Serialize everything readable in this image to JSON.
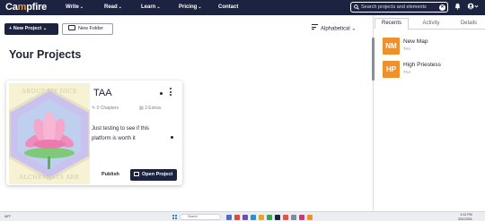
{
  "brand": {
    "name_start": "Ca",
    "name_flame": "m",
    "name_end": "pfire"
  },
  "nav": {
    "items": [
      {
        "label": "Write",
        "has_menu": true
      },
      {
        "label": "Read",
        "has_menu": true
      },
      {
        "label": "Learn",
        "has_menu": true
      },
      {
        "label": "Pricing",
        "has_menu": true
      },
      {
        "label": "Contact",
        "has_menu": false
      }
    ],
    "chevron": "⌄",
    "search_placeholder": "Search projects and elements",
    "search_icon": "search-icon",
    "clear_icon": "✕",
    "bell_icon": "bell-icon",
    "account_icon": "user-icon"
  },
  "toolbar": {
    "new_project_label": "+ New Project ⌄",
    "new_folder_label": "New Folder",
    "sort_label": "Alphabetical",
    "sort_chevron": "⌄"
  },
  "main": {
    "heading": "Your Projects"
  },
  "project": {
    "title": "TAA",
    "chapters_icon": "✎",
    "chapters": "0 Chapters",
    "extras_icon": "▤",
    "extras": "3 Extras",
    "description": "Just testing to see if this platform is worth it",
    "cover_top": "ABOUT MY NICE",
    "cover_bottom": "ALCHEMISTS ARE",
    "publish_label": "Publish",
    "open_label": "Open Project"
  },
  "panel": {
    "tabs": [
      {
        "label": "Recents",
        "active": true
      },
      {
        "label": "Activity",
        "active": false
      },
      {
        "label": "Details",
        "active": false
      }
    ],
    "recents": [
      {
        "badge": "NM",
        "title": "New Map",
        "subtitle": "TAA"
      },
      {
        "badge": "HP",
        "title": "High Priestess",
        "subtitle": "TAA"
      }
    ]
  },
  "taskbar": {
    "weather": "68°F",
    "search": "Search",
    "time": "3:12 PM",
    "date": "3/31/2024"
  },
  "colors": {
    "nav_bg": "#1c2340",
    "accent_orange": "#f0902c",
    "cover_bg": "#f7f2d4"
  }
}
